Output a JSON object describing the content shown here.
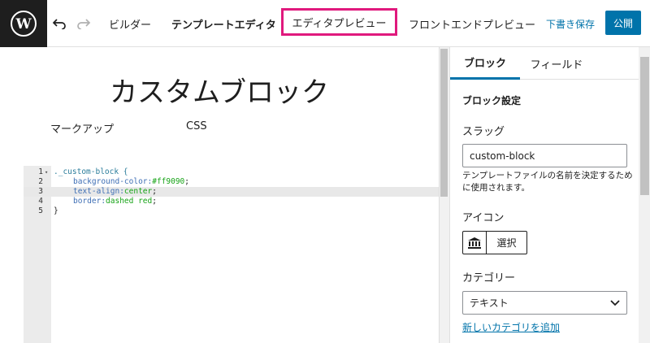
{
  "header": {
    "logo_icon": "wordpress-icon",
    "undo_icon": "undo-icon",
    "redo_icon": "redo-icon",
    "nav_builder": "ビルダー",
    "nav_template_editor": "テンプレートエディタ",
    "nav_editor_preview": "エディタプレビュー",
    "nav_frontend_preview": "フロントエンドプレビュー",
    "save_draft": "下書き保存",
    "publish": "公開",
    "highlight_color": "#e0197d",
    "accent_color": "#0073aa"
  },
  "editor": {
    "block_title": "カスタムブロック",
    "tab_markup": "マークアップ",
    "tab_css": "CSS",
    "code_lines": [
      {
        "num": "1",
        "fold": "▾",
        "selector": "._custom-block {"
      },
      {
        "num": "2",
        "prop": "background-color:",
        "val": "#ff9090",
        "end": ";"
      },
      {
        "num": "3",
        "prop": "text-align:",
        "val": "center",
        "end": ";"
      },
      {
        "num": "4",
        "prop": "border:",
        "val": "dashed red",
        "end": ";"
      },
      {
        "num": "5",
        "close": "}"
      }
    ]
  },
  "sidebar": {
    "tab_block": "ブロック",
    "tab_field": "フィールド",
    "section_title": "ブロック設定",
    "slug_label": "スラッグ",
    "slug_value": "custom-block",
    "slug_help": "テンプレートファイルの名前を決定するために使用されます。",
    "icon_label": "アイコン",
    "icon_name": "bank-icon",
    "icon_select": "選択",
    "category_label": "カテゴリー",
    "category_value": "テキスト",
    "add_category_link": "新しいカテゴリを追加"
  }
}
